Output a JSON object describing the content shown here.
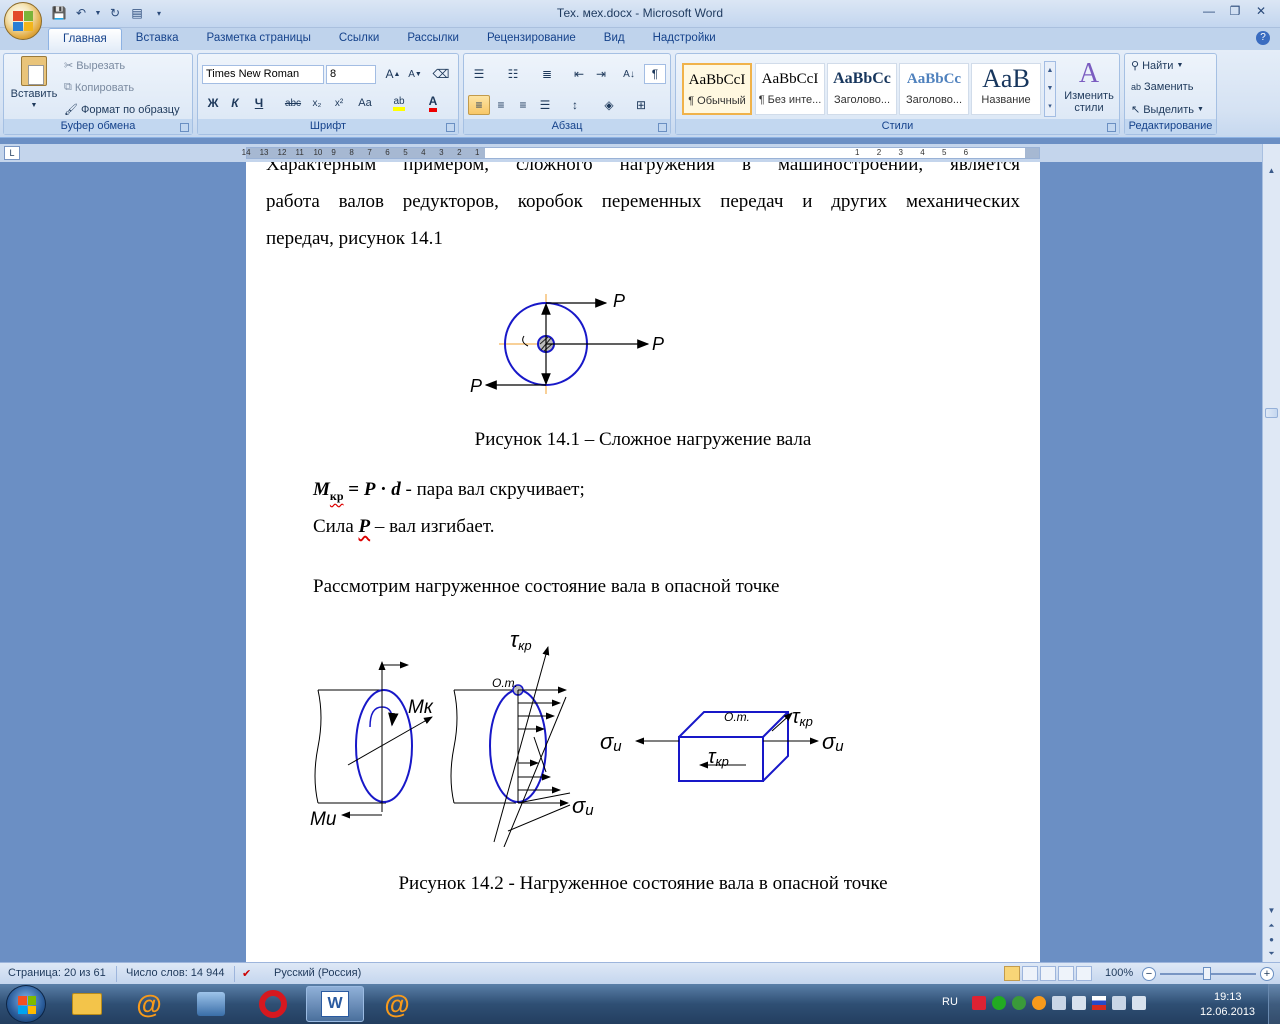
{
  "window": {
    "title": "Тех. мех.docx - Microsoft Word"
  },
  "tabs": [
    "Главная",
    "Вставка",
    "Разметка страницы",
    "Ссылки",
    "Рассылки",
    "Рецензирование",
    "Вид",
    "Надстройки"
  ],
  "clipboard": {
    "paste": "Вставить",
    "cut": "Вырезать",
    "copy": "Копировать",
    "format_painter": "Формат по образцу",
    "label": "Буфер обмена"
  },
  "font": {
    "name": "Times New Roman",
    "size": "8",
    "label": "Шрифт"
  },
  "paragraph": {
    "label": "Абзац"
  },
  "styles": {
    "items": [
      {
        "preview": "AaBbCcI",
        "name": "¶ Обычный"
      },
      {
        "preview": "AaBbCcI",
        "name": "¶ Без инте..."
      },
      {
        "preview": "AaBbCc",
        "name": "Заголово..."
      },
      {
        "preview": "AaBbCc",
        "name": "Заголово..."
      },
      {
        "preview": "AaB",
        "name": "Название"
      }
    ],
    "change": "Изменить стили",
    "label": "Стили"
  },
  "editing": {
    "find": "Найти",
    "replace": "Заменить",
    "select": "Выделить",
    "label": "Редактирование"
  },
  "ruler": {
    "left_numbers": [
      "14",
      "13",
      "12",
      "11",
      "10",
      "9",
      "8",
      "7",
      "6",
      "5",
      "4",
      "3",
      "2",
      "1"
    ],
    "right_numbers": [
      "1",
      "2",
      "3",
      "4",
      "5",
      "6"
    ]
  },
  "document": {
    "line1": "Характерным примером, сложного нагружения в машиностроении, является",
    "line2": "работа валов редукторов, коробок переменных передач и других механических",
    "line3": "передач, рисунок 14.1",
    "fig1_label": "P",
    "caption1": "Рисунок 14.1 – Сложное нагружение вала",
    "formula": {
      "m": "M",
      "sub": "кр",
      "eq": " = ",
      "p": "P",
      "dot": " · ",
      "d": "d",
      "rest": "  - пара вал скручивает;"
    },
    "line_force": {
      "a": "Сила ",
      "p": "P",
      "b": " – вал изгибает."
    },
    "line_consider": "Рассмотрим нагруженное состояние вала в опасной точке",
    "fig2": {
      "tau": "τ",
      "kr": "кр",
      "ot": "О.т.",
      "mk": "Мк",
      "mi": "Ми",
      "sigma": "σ",
      "i": "и"
    },
    "caption2": "Рисунок 14.2 - Нагруженное состояние вала в опасной точке"
  },
  "status": {
    "page": "Страница: 20 из 61",
    "words": "Число слов: 14 944",
    "lang": "Русский (Россия)",
    "zoom": "100%"
  },
  "taskbar": {
    "lang": "RU",
    "time": "19:13",
    "date": "12.06.2013"
  }
}
